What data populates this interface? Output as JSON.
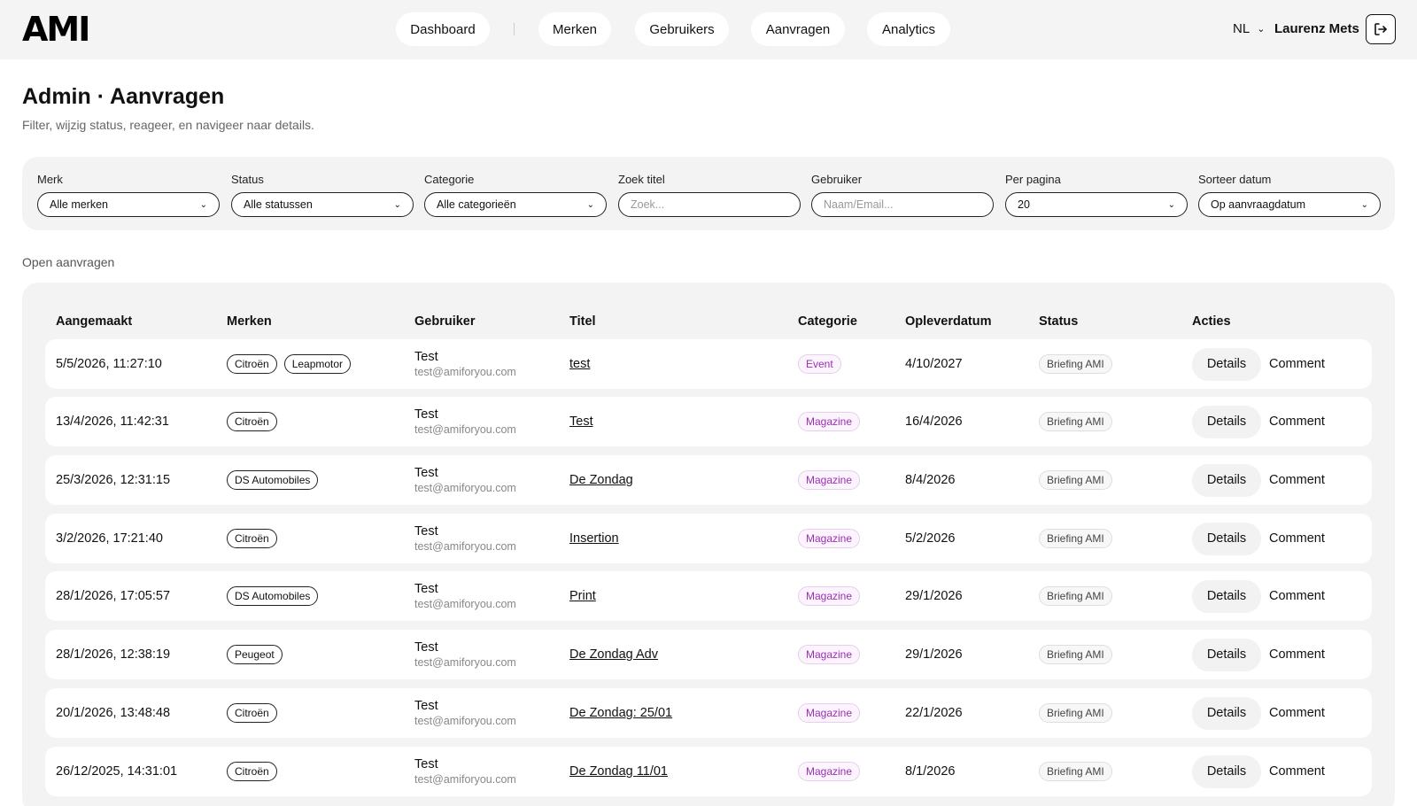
{
  "header": {
    "logo": "AMI",
    "nav": [
      "Dashboard",
      "Merken",
      "Gebruikers",
      "Aanvragen",
      "Analytics"
    ],
    "lang": "NL",
    "user": "Laurenz Mets"
  },
  "page": {
    "title": "Admin · Aanvragen",
    "subtitle": "Filter, wijzig status, reageer, en navigeer naar details."
  },
  "filters": [
    {
      "label": "Merk",
      "value": "Alle merken",
      "kind": "select"
    },
    {
      "label": "Status",
      "value": "Alle statussen",
      "kind": "select"
    },
    {
      "label": "Categorie",
      "value": "Alle categorieën",
      "kind": "select"
    },
    {
      "label": "Zoek titel",
      "placeholder": "Zoek...",
      "kind": "input"
    },
    {
      "label": "Gebruiker",
      "placeholder": "Naam/Email...",
      "kind": "input"
    },
    {
      "label": "Per pagina",
      "value": "20",
      "kind": "select"
    },
    {
      "label": "Sorteer datum",
      "value": "Op aanvraagdatum",
      "kind": "select"
    }
  ],
  "section_label": "Open aanvragen",
  "table": {
    "headers": [
      "Aangemaakt",
      "Merken",
      "Gebruiker",
      "Titel",
      "Categorie",
      "Opleverdatum",
      "Status",
      "Acties"
    ],
    "details_label": "Details",
    "comment_label": "Comment",
    "rows": [
      {
        "created": "5/5/2026, 11:27:10",
        "brands": [
          "Citroën",
          "Leapmotor"
        ],
        "user": "Test",
        "email": "test@amiforyou.com",
        "title": "test",
        "category": "Event",
        "delivery": "4/10/2027",
        "status": "Briefing AMI"
      },
      {
        "created": "13/4/2026, 11:42:31",
        "brands": [
          "Citroën"
        ],
        "user": "Test",
        "email": "test@amiforyou.com",
        "title": "Test",
        "category": "Magazine",
        "delivery": "16/4/2026",
        "status": "Briefing AMI"
      },
      {
        "created": "25/3/2026, 12:31:15",
        "brands": [
          "DS Automobiles"
        ],
        "user": "Test",
        "email": "test@amiforyou.com",
        "title": "De Zondag",
        "category": "Magazine",
        "delivery": "8/4/2026",
        "status": "Briefing AMI"
      },
      {
        "created": "3/2/2026, 17:21:40",
        "brands": [
          "Citroën"
        ],
        "user": "Test",
        "email": "test@amiforyou.com",
        "title": "Insertion",
        "category": "Magazine",
        "delivery": "5/2/2026",
        "status": "Briefing AMI"
      },
      {
        "created": "28/1/2026, 17:05:57",
        "brands": [
          "DS Automobiles"
        ],
        "user": "Test",
        "email": "test@amiforyou.com",
        "title": "Print",
        "category": "Magazine",
        "delivery": "29/1/2026",
        "status": "Briefing AMI"
      },
      {
        "created": "28/1/2026, 12:38:19",
        "brands": [
          "Peugeot"
        ],
        "user": "Test",
        "email": "test@amiforyou.com",
        "title": "De Zondag Adv",
        "category": "Magazine",
        "delivery": "29/1/2026",
        "status": "Briefing AMI"
      },
      {
        "created": "20/1/2026, 13:48:48",
        "brands": [
          "Citroën"
        ],
        "user": "Test",
        "email": "test@amiforyou.com",
        "title": "De Zondag: 25/01",
        "category": "Magazine",
        "delivery": "22/1/2026",
        "status": "Briefing AMI"
      },
      {
        "created": "26/12/2025, 14:31:01",
        "brands": [
          "Citroën"
        ],
        "user": "Test",
        "email": "test@amiforyou.com",
        "title": "De Zondag 11/01",
        "category": "Magazine",
        "delivery": "8/1/2026",
        "status": "Briefing AMI"
      }
    ]
  },
  "icons": {
    "logout": "logout-icon",
    "chevron": "chevron-down-icon"
  }
}
